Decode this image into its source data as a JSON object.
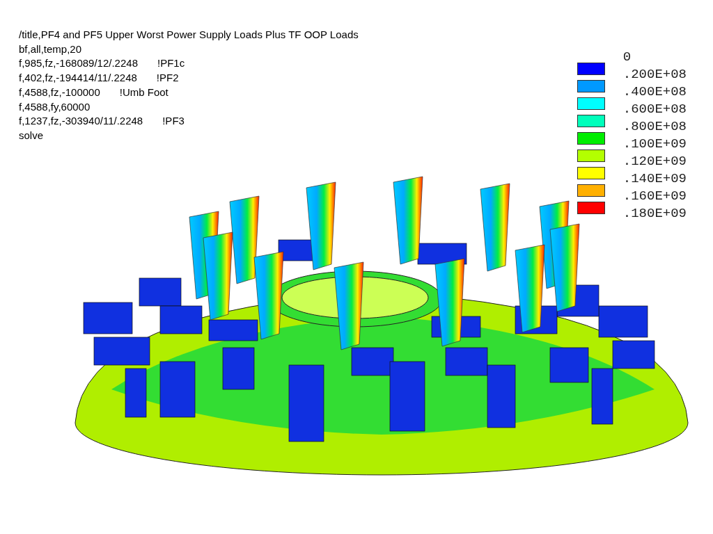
{
  "commands": [
    {
      "text": "/title,PF4 and PF5 Upper Worst Power Supply Loads Plus TF OOP Loads"
    },
    {
      "text": "bf,all,temp,20"
    },
    {
      "text": "f,985,fz,-168089/12/.2248",
      "comment": "!PF1c"
    },
    {
      "text": "f,402,fz,-194414/11/.2248",
      "comment": "!PF2"
    },
    {
      "text": "f,4588,fz,-100000",
      "comment": "!Umb Foot"
    },
    {
      "text": "f,4588,fy,60000"
    },
    {
      "text": "f,1237,fz,-303940/11/.2248",
      "comment": "!PF3"
    },
    {
      "text": "solve"
    }
  ],
  "legend": {
    "labels": [
      "0",
      ".200E+08",
      ".400E+08",
      ".600E+08",
      ".800E+08",
      ".100E+09",
      ".120E+09",
      ".140E+09",
      ".160E+09",
      ".180E+09"
    ],
    "swatches": [
      {
        "color": "#0000ff"
      },
      {
        "color": "#0099ff"
      },
      {
        "color": "#00ffff"
      },
      {
        "color": "#00ffbb"
      },
      {
        "color": "#00ee00"
      },
      {
        "color": "#b3ff00"
      },
      {
        "color": "#ffff00"
      },
      {
        "color": "#ffb000"
      },
      {
        "color": "#ff0000"
      }
    ]
  }
}
